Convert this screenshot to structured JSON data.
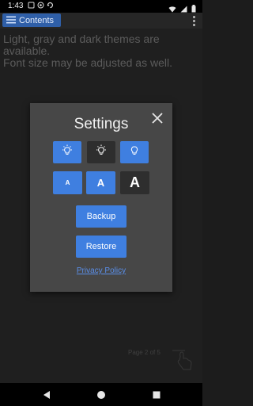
{
  "status_bar": {
    "time": "1:43",
    "icons": [
      "storage-icon",
      "alert-icon",
      "sync-icon"
    ],
    "right_icons": [
      "wifi-icon",
      "signal-icon",
      "battery-icon"
    ]
  },
  "toolbar": {
    "contents_label": "Contents",
    "contents_icon": "list-icon",
    "menu_icon": "overflow-menu-icon"
  },
  "body": {
    "line1": "Light, gray and dark themes are",
    "line2": "available.",
    "line3": "Font size may be adjusted as well.",
    "page_indicator": "Page 2 of 5"
  },
  "dialog": {
    "title": "Settings",
    "close_icon": "close-icon",
    "theme_buttons": [
      {
        "name": "light-theme",
        "icon": "lightbulb-icon",
        "selected": false
      },
      {
        "name": "dark-theme",
        "icon": "lightbulb-icon",
        "selected": true
      },
      {
        "name": "gray-theme",
        "icon": "lightbulb-icon",
        "selected": false
      }
    ],
    "font_buttons": [
      {
        "label": "A",
        "size": "small",
        "selected": false
      },
      {
        "label": "A",
        "size": "medium",
        "selected": false
      },
      {
        "label": "A",
        "size": "large",
        "selected": true
      }
    ],
    "backup_label": "Backup",
    "restore_label": "Restore",
    "privacy_label": "Privacy Policy"
  },
  "colors": {
    "accent": "#3f7fe0",
    "dialog_bg": "#474747",
    "link": "#5a8ee8"
  }
}
